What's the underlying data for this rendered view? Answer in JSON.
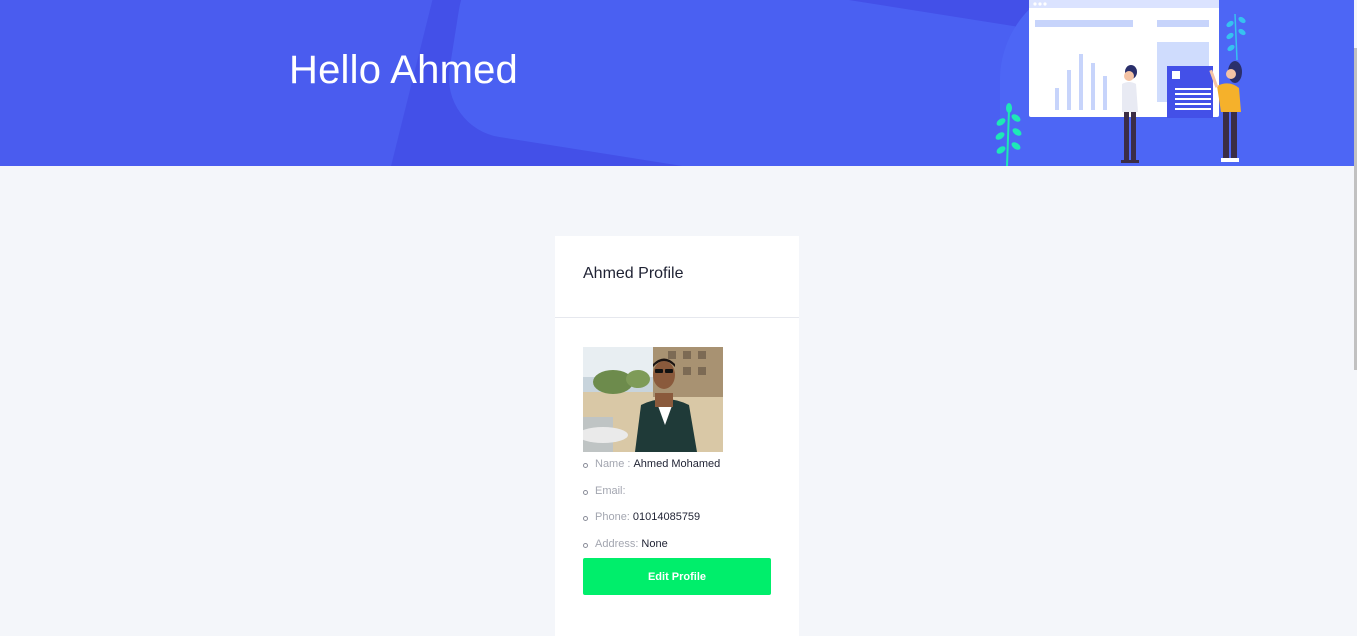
{
  "hero": {
    "title": "Hello Ahmed",
    "background_color": "#4350e8",
    "illustration": "dashboard-presentation-illustration"
  },
  "profile_card": {
    "title": "Ahmed Profile",
    "avatar": "profile-photo",
    "fields": [
      {
        "label": "Name :",
        "value": "Ahmed Mohamed"
      },
      {
        "label": "Email:",
        "value": ""
      },
      {
        "label": "Phone:",
        "value": "01014085759"
      },
      {
        "label": "Address:",
        "value": "None"
      }
    ],
    "edit_button_label": "Edit Profile",
    "edit_button_color": "#00ee6b"
  },
  "page_background": "#f4f6fa"
}
